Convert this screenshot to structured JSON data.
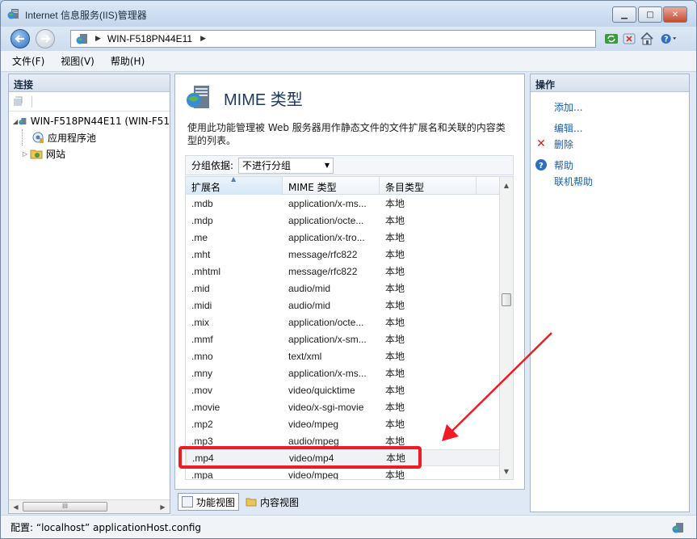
{
  "window": {
    "title": "Internet 信息服务(IIS)管理器",
    "min_glyph": "▁",
    "max_glyph": "□",
    "close_glyph": "✕"
  },
  "address": {
    "crumb": "WIN-F518PN44E11",
    "sep": "▶"
  },
  "menu": {
    "file": "文件(F)",
    "view": "视图(V)",
    "help": "帮助(H)"
  },
  "connections": {
    "header": "连接",
    "server_node": "WIN-F518PN44E11 (WIN-F51",
    "app_pools": "应用程序池",
    "sites": "网站",
    "scroll_grip": "III"
  },
  "feature": {
    "title": "MIME 类型",
    "description": "使用此功能管理被 Web 服务器用作静态文件的文件扩展名和关联的内容类型的列表。",
    "group_label": "分组依据:",
    "group_value": "不进行分组"
  },
  "grid": {
    "columns": [
      "扩展名",
      "MIME 类型",
      "条目类型"
    ],
    "rows": [
      {
        "ext": ".mdb",
        "mime": "application/x-ms...",
        "type": "本地"
      },
      {
        "ext": ".mdp",
        "mime": "application/octe...",
        "type": "本地"
      },
      {
        "ext": ".me",
        "mime": "application/x-tro...",
        "type": "本地"
      },
      {
        "ext": ".mht",
        "mime": "message/rfc822",
        "type": "本地"
      },
      {
        "ext": ".mhtml",
        "mime": "message/rfc822",
        "type": "本地"
      },
      {
        "ext": ".mid",
        "mime": "audio/mid",
        "type": "本地"
      },
      {
        "ext": ".midi",
        "mime": "audio/mid",
        "type": "本地"
      },
      {
        "ext": ".mix",
        "mime": "application/octe...",
        "type": "本地"
      },
      {
        "ext": ".mmf",
        "mime": "application/x-sm...",
        "type": "本地"
      },
      {
        "ext": ".mno",
        "mime": "text/xml",
        "type": "本地"
      },
      {
        "ext": ".mny",
        "mime": "application/x-ms...",
        "type": "本地"
      },
      {
        "ext": ".mov",
        "mime": "video/quicktime",
        "type": "本地"
      },
      {
        "ext": ".movie",
        "mime": "video/x-sgi-movie",
        "type": "本地"
      },
      {
        "ext": ".mp2",
        "mime": "video/mpeg",
        "type": "本地"
      },
      {
        "ext": ".mp3",
        "mime": "audio/mpeg",
        "type": "本地"
      },
      {
        "ext": ".mp4",
        "mime": "video/mp4",
        "type": "本地"
      },
      {
        "ext": ".mpa",
        "mime": "video/mpeg",
        "type": "本地"
      }
    ],
    "selected_ext": ".mp4"
  },
  "views": {
    "features": "功能视图",
    "content": "内容视图"
  },
  "actions": {
    "header": "操作",
    "add": "添加...",
    "edit": "编辑...",
    "remove": "删除",
    "help": "帮助",
    "online_help": "联机帮助"
  },
  "status": {
    "text": "配置: “localhost” applicationHost.config"
  },
  "colors": {
    "annotation": "#ee1c24",
    "link": "#1f5fa6"
  }
}
